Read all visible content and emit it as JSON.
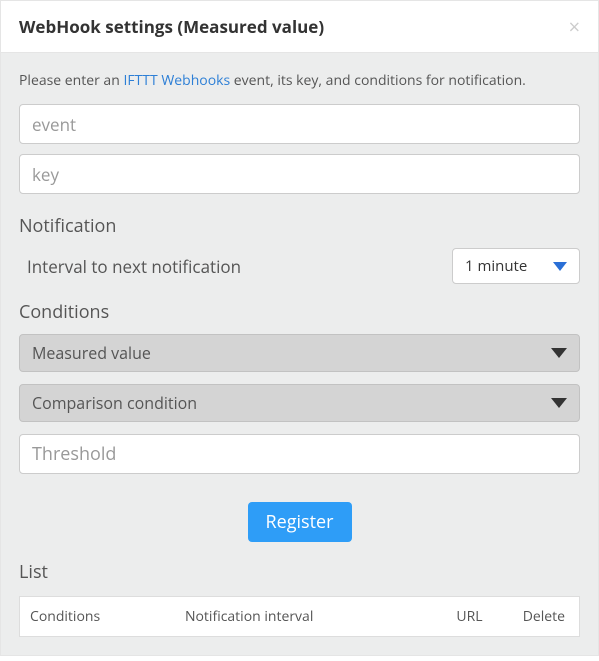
{
  "header": {
    "title": "WebHook settings (Measured value)"
  },
  "intro": {
    "prefix": "Please enter an ",
    "link_text": "IFTTT Webhooks",
    "suffix": " event, its key, and conditions for notification."
  },
  "inputs": {
    "event_placeholder": "event",
    "key_placeholder": "key",
    "threshold_placeholder": "Threshold"
  },
  "notification": {
    "section_label": "Notification",
    "interval_label": "Interval to next notification",
    "interval_value": "1 minute"
  },
  "conditions": {
    "section_label": "Conditions",
    "measured_value_label": "Measured value",
    "comparison_label": "Comparison condition"
  },
  "buttons": {
    "register": "Register"
  },
  "list": {
    "section_label": "List",
    "columns": {
      "conditions": "Conditions",
      "interval": "Notification interval",
      "url": "URL",
      "delete": "Delete"
    }
  }
}
